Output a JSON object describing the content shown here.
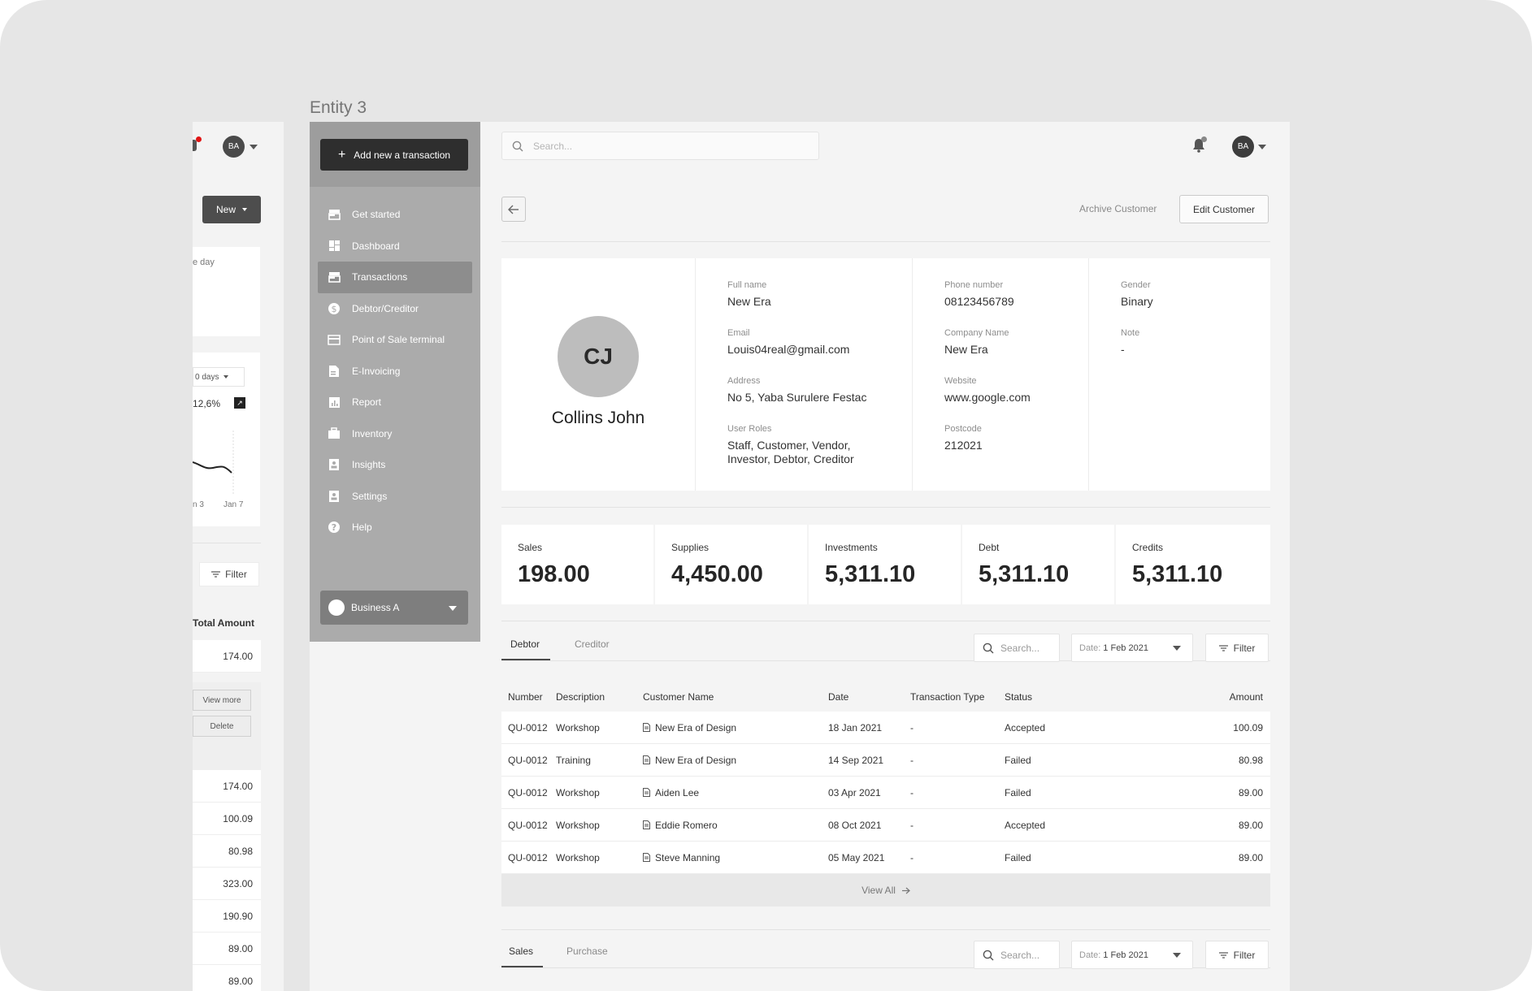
{
  "entity_title": "Entity 3",
  "left_frame": {
    "avatar": "BA",
    "new_button": "New",
    "card_text": "e day",
    "days_select": "0 days",
    "percent": "12,6%",
    "tick_labels": [
      "n 3",
      "Jan 7"
    ],
    "filter_label": "Filter",
    "total_header": "Total Amount",
    "first_value": "174.00",
    "view_more": "View more",
    "delete": "Delete",
    "values": [
      "174.00",
      "100.09",
      "80.98",
      "323.00",
      "190.90",
      "89.00",
      "89.00"
    ]
  },
  "sidebar": {
    "add_button": "Add new a transaction",
    "items": [
      {
        "label": "Get started",
        "icon": "store-icon"
      },
      {
        "label": "Dashboard",
        "icon": "dashboard-icon"
      },
      {
        "label": "Transactions",
        "icon": "store-icon"
      },
      {
        "label": "Debtor/Creditor",
        "icon": "dollar-icon"
      },
      {
        "label": "Point of Sale terminal",
        "icon": "card-icon"
      },
      {
        "label": "E-Invoicing",
        "icon": "invoice-icon"
      },
      {
        "label": "Report",
        "icon": "report-icon"
      },
      {
        "label": "Inventory",
        "icon": "briefcase-icon"
      },
      {
        "label": "Insights",
        "icon": "contact-icon"
      },
      {
        "label": "Settings",
        "icon": "contact-icon"
      },
      {
        "label": "Help",
        "icon": "help-icon"
      }
    ],
    "active_index": 2,
    "business": "Business A"
  },
  "header": {
    "search_placeholder": "Search...",
    "avatar": "BA"
  },
  "actions": {
    "archive": "Archive Customer",
    "edit": "Edit Customer"
  },
  "profile": {
    "initials": "CJ",
    "name": "Collins John",
    "full_name_label": "Full name",
    "full_name": "New Era",
    "email_label": "Email",
    "email": "Louis04real@gmail.com",
    "address_label": "Address",
    "address": "No 5, Yaba Surulere Festac",
    "roles_label": "User Roles",
    "roles": "Staff, Customer, Vendor, Investor, Debtor, Creditor",
    "phone_label": "Phone number",
    "phone": "08123456789",
    "company_label": "Company Name",
    "company": "New Era",
    "website_label": "Website",
    "website": "www.google.com",
    "postcode_label": "Postcode",
    "postcode": "212021",
    "gender_label": "Gender",
    "gender": "Binary",
    "note_label": "Note",
    "note": "-"
  },
  "stats": [
    {
      "label": "Sales",
      "value": "198.00"
    },
    {
      "label": "Supplies",
      "value": "4,450.00"
    },
    {
      "label": "Investments",
      "value": "5,311.10"
    },
    {
      "label": "Debt",
      "value": "5,311.10"
    },
    {
      "label": "Credits",
      "value": "5,311.10"
    }
  ],
  "debtor_section": {
    "tabs": [
      "Debtor",
      "Creditor"
    ],
    "search_placeholder": "Search...",
    "date_prefix": "Date:",
    "date_value": "1 Feb 2021",
    "filter": "Filter"
  },
  "table": {
    "headers": [
      "Number",
      "Description",
      "Customer Name",
      "Date",
      "Transaction Type",
      "Status",
      "Amount"
    ],
    "rows": [
      [
        "QU-0012",
        "Workshop",
        "New Era of Design",
        "18 Jan 2021",
        "-",
        "Accepted",
        "100.09"
      ],
      [
        "QU-0012",
        "Training",
        "New Era of Design",
        "14 Sep 2021",
        "-",
        "Failed",
        "80.98"
      ],
      [
        "QU-0012",
        "Workshop",
        "Aiden Lee",
        "03 Apr 2021",
        "-",
        "Failed",
        "89.00"
      ],
      [
        "QU-0012",
        "Workshop",
        "Eddie Romero",
        "08 Oct 2021",
        "-",
        "Accepted",
        "89.00"
      ],
      [
        "QU-0012",
        "Workshop",
        "Steve Manning",
        "05 May 2021",
        "-",
        "Failed",
        "89.00"
      ]
    ],
    "view_all": "View All"
  },
  "sales_section": {
    "tabs": [
      "Sales",
      "Purchase"
    ],
    "search_placeholder": "Search...",
    "date_prefix": "Date:",
    "date_value": "1 Feb 2021",
    "filter": "Filter"
  }
}
